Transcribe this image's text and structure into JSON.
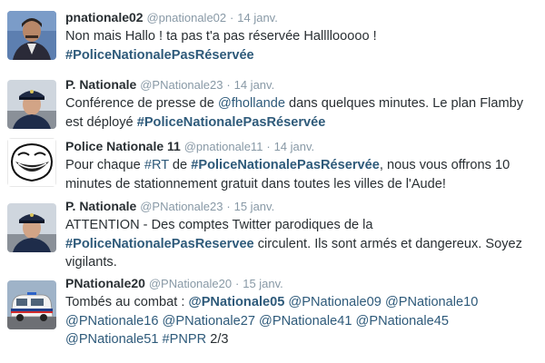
{
  "tweets": [
    {
      "name": "pnationale02",
      "handle": "@pnationale02",
      "sep": "·",
      "date": "14 janv.",
      "line1": "Non mais Hallo ! ta pas t'a pas réservée Hallllooooo !",
      "hashtag1": "#PoliceNationalePasRéservée",
      "avatar_icon": "man-portrait-avatar"
    },
    {
      "name": "P. Nationale",
      "handle": "@PNationale23",
      "sep": "·",
      "date": "14 janv.",
      "text_a": "Conférence de presse de ",
      "mention1": "@fhollande",
      "text_b": " dans quelques minutes. Le plan Flamby est déployé ",
      "hashtag1": "#PoliceNationalePasRéservée",
      "avatar_icon": "police-officer-avatar"
    },
    {
      "name": "Police Nationale 11",
      "handle": "@pnationale11",
      "sep": "·",
      "date": "14 janv.",
      "text_a": "Pour chaque ",
      "hashtag_rt": "#RT",
      "text_b": " de ",
      "hashtag1": "#PoliceNationalePasRéservée",
      "text_c": ", nous vous offrons 10 minutes de stationnement gratuit dans toutes les villes de l'Aude!",
      "avatar_icon": "trollface-avatar"
    },
    {
      "name": "P. Nationale",
      "handle": "@PNationale23",
      "sep": "·",
      "date": "15 janv.",
      "text_a": "ATTENTION - Des comptes Twitter parodiques de la ",
      "hashtag1": "#PoliceNationalePasReservee",
      "text_b": " circulent. Ils sont armés et dangereux. Soyez vigilants.",
      "avatar_icon": "police-officer-avatar"
    },
    {
      "name": "PNationale20",
      "handle": "@PNationale20",
      "sep": "·",
      "date": "15 janv.",
      "text_a": "Tombés au combat : ",
      "m1": "@PNationale05",
      "m2": "@PNationale09",
      "m3": "@PNationale10",
      "m4": "@PNationale16",
      "m5": "@PNationale27",
      "m6": "@PNationale41",
      "m7": "@PNationale45",
      "m8": "@PNationale51",
      "hashtag1": "#PNPR",
      "text_end": " 2/3",
      "avatar_icon": "police-car-avatar"
    }
  ]
}
